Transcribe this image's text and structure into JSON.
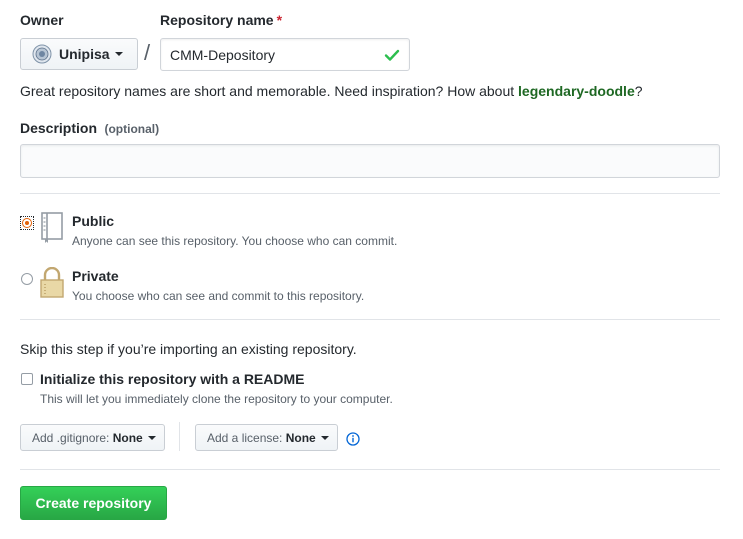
{
  "owner": {
    "label": "Owner",
    "value": "Unipisa",
    "avatar_icon": "org-seal-icon"
  },
  "separator": "/",
  "repo_name": {
    "label": "Repository name",
    "required_mark": "*",
    "value": "CMM-Depository",
    "valid_icon": "check-icon"
  },
  "hint": {
    "prefix": "Great repository names are short and memorable. Need inspiration? How about ",
    "suggestion": "legendary-doodle",
    "suffix": "?"
  },
  "description": {
    "label": "Description",
    "optional": "(optional)",
    "value": ""
  },
  "visibility": {
    "public": {
      "title": "Public",
      "note": "Anyone can see this repository. You choose who can commit.",
      "icon": "repo-book-icon",
      "selected": true
    },
    "private": {
      "title": "Private",
      "note": "You choose who can see and commit to this repository.",
      "icon": "lock-icon",
      "selected": false
    }
  },
  "init": {
    "skip_text": "Skip this step if you’re importing an existing repository.",
    "readme_label": "Initialize this repository with a README",
    "readme_note": "This will let you immediately clone the repository to your computer.",
    "readme_checked": false
  },
  "gitignore": {
    "prefix": "Add .gitignore: ",
    "value": "None"
  },
  "license": {
    "prefix": "Add a license: ",
    "value": "None"
  },
  "info_icon": "info-icon",
  "create_button": "Create repository",
  "colors": {
    "accent_green": "#2cbe4e",
    "suggestion_green": "#1e6823",
    "required_red": "#cb2431",
    "radio_selected": "#e36209",
    "info_blue": "#0366d6"
  }
}
